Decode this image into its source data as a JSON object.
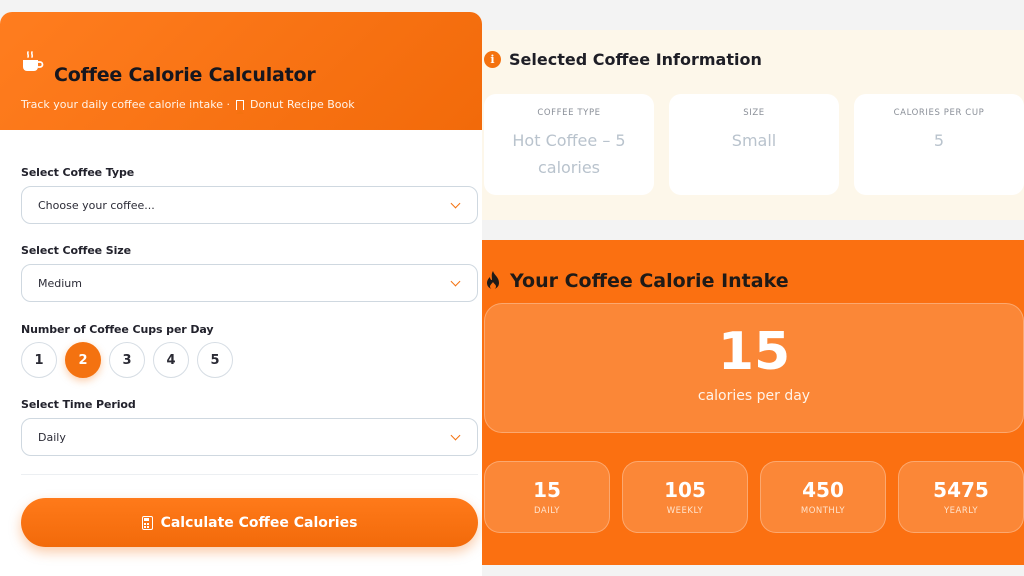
{
  "calculator": {
    "title": "Coffee Calorie Calculator",
    "subtitle": "Track your daily coffee calorie intake ·",
    "subtitle_link": "Donut Recipe Book",
    "coffee_type": {
      "label": "Select Coffee Type",
      "value": "Choose your coffee..."
    },
    "coffee_size": {
      "label": "Select Coffee Size",
      "value": "Medium"
    },
    "cups": {
      "label": "Number of Coffee Cups per Day",
      "options": [
        "1",
        "2",
        "3",
        "4",
        "5"
      ],
      "selected": "2"
    },
    "time_period": {
      "label": "Select Time Period",
      "value": "Daily"
    },
    "calculate_label": "Calculate Coffee Calories"
  },
  "info": {
    "title": "Selected Coffee Information",
    "icon": "info-icon",
    "cards": [
      {
        "key": "COFFEE TYPE",
        "value": "Hot Coffee – 5 calories"
      },
      {
        "key": "SIZE",
        "value": "Small"
      },
      {
        "key": "CALORIES PER CUP",
        "value": "5"
      }
    ]
  },
  "result": {
    "title": "Your Coffee Calorie Intake",
    "icon": "flame-icon",
    "main_value": "15",
    "main_label": "calories per day",
    "stats": [
      {
        "value": "15",
        "label": "DAILY"
      },
      {
        "value": "105",
        "label": "WEEKLY"
      },
      {
        "value": "450",
        "label": "MONTHLY"
      },
      {
        "value": "5475",
        "label": "YEARLY"
      }
    ]
  },
  "colors": {
    "accent": "#f47210",
    "info_bg": "#fdf7ea",
    "result_bg": "#fb7011"
  }
}
